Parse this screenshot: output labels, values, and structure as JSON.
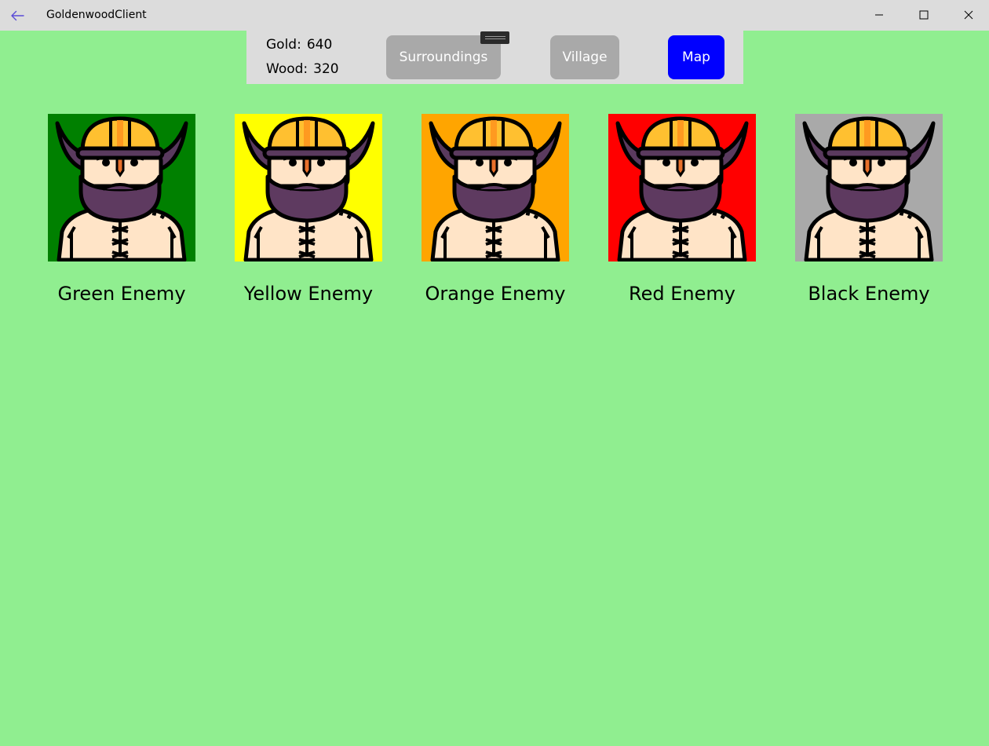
{
  "window": {
    "title": "GoldenwoodClient"
  },
  "resources": {
    "gold_label": "Gold:",
    "gold_value": "640",
    "wood_label": "Wood:",
    "wood_value": "320"
  },
  "nav": {
    "surroundings_label": "Surroundings",
    "village_label": "Village",
    "map_label": "Map"
  },
  "enemies": [
    {
      "label": "Green Enemy",
      "color": "#008000"
    },
    {
      "label": "Yellow Enemy",
      "color": "#ffff00"
    },
    {
      "label": "Orange Enemy",
      "color": "#ffa500"
    },
    {
      "label": "Red Enemy",
      "color": "#ff0000"
    },
    {
      "label": "Black Enemy",
      "color": "#a9a9a9"
    }
  ],
  "colors": {
    "page_background": "#90ee90",
    "panel_background": "#dcdcdc",
    "nav_button_inactive": "#a9a9a9",
    "nav_button_active": "#0000ff",
    "back_arrow": "#5a4bd6"
  },
  "icons": {
    "back": "back-arrow-icon",
    "minimize": "minimize-icon",
    "maximize": "maximize-icon",
    "close": "close-icon",
    "portrait": "viking-warrior-icon"
  }
}
